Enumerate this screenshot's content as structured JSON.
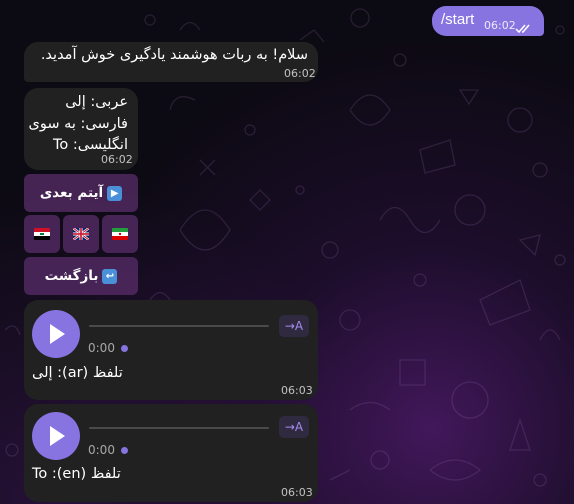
{
  "colors": {
    "accent": "#8774e1",
    "bubble": "#212121",
    "keyboard_button": "#562c66"
  },
  "outgoing": {
    "text": "/start",
    "time": "06:02",
    "status_icon": "double-check-icon"
  },
  "messages": {
    "welcome": {
      "text": "سلام! به ربات هوشمند یادگیری خوش آمدید.",
      "time": "06:02"
    },
    "translations": {
      "lines": [
        "عربی: إلى",
        "فارسی: به سوی",
        "انگلیسی: To"
      ],
      "time": "06:02"
    }
  },
  "keyboard": {
    "next_label": "آیتم بعدی",
    "next_icon": "play-icon",
    "flags": [
      "iraq-flag-icon",
      "uk-flag-icon",
      "iran-flag-icon"
    ],
    "back_label": "بازگشت",
    "back_icon": "return-icon"
  },
  "voices": [
    {
      "duration": "0:00",
      "transcribe_label": "→A",
      "caption": "تلفظ (ar): إلى",
      "time": "06:03"
    },
    {
      "duration": "0:00",
      "transcribe_label": "→A",
      "caption": "تلفظ (en): To",
      "time": "06:03"
    }
  ]
}
